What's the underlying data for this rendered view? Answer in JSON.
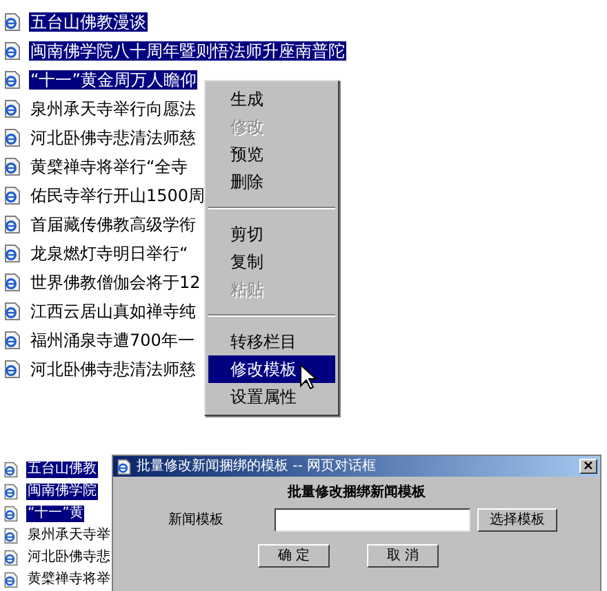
{
  "news_list": [
    {
      "title": "五台山佛教漫谈",
      "selected": true
    },
    {
      "title": "闽南佛学院八十周年暨则悟法师升座南普陀",
      "selected": true
    },
    {
      "title": "“十一”黄金周万人瞻仰",
      "selected": true
    },
    {
      "title": "泉州承天寺举行向愿法",
      "selected": false
    },
    {
      "title": "河北卧佛寺悲清法师慈",
      "selected": false
    },
    {
      "title": "黄檗禅寺将举行“全寺",
      "selected": false
    },
    {
      "title": "佑民寺举行开山1500周",
      "selected": false
    },
    {
      "title": "首届藏传佛教高级学衔",
      "selected": false
    },
    {
      "title": "龙泉燃灯寺明日举行“",
      "selected": false
    },
    {
      "title": "世界佛教僧伽会将于12",
      "selected": false
    },
    {
      "title": "江西云居山真如禅寺纯",
      "selected": false
    },
    {
      "title": "福州涌泉寺遭700年一",
      "selected": false
    },
    {
      "title": "河北卧佛寺悲清法师慈",
      "selected": false
    }
  ],
  "context_menu": [
    {
      "kind": "item",
      "label": "生成",
      "disabled": false,
      "selected": false
    },
    {
      "kind": "item",
      "label": "修改",
      "disabled": true,
      "selected": false
    },
    {
      "kind": "item",
      "label": "预览",
      "disabled": false,
      "selected": false
    },
    {
      "kind": "item",
      "label": "删除",
      "disabled": false,
      "selected": false
    },
    {
      "kind": "separator"
    },
    {
      "kind": "item",
      "label": "剪切",
      "disabled": false,
      "selected": false
    },
    {
      "kind": "item",
      "label": "复制",
      "disabled": false,
      "selected": false
    },
    {
      "kind": "item",
      "label": "粘贴",
      "disabled": true,
      "selected": false
    },
    {
      "kind": "separator"
    },
    {
      "kind": "item",
      "label": "转移栏目",
      "disabled": false,
      "selected": false
    },
    {
      "kind": "item",
      "label": "修改模板",
      "disabled": false,
      "selected": true
    },
    {
      "kind": "item",
      "label": "设置属性",
      "disabled": false,
      "selected": false
    }
  ],
  "background_list": [
    {
      "title": "五台山佛教",
      "selected": true
    },
    {
      "title": "闽南佛学院",
      "selected": true
    },
    {
      "title": "“十一”黄",
      "selected": true
    },
    {
      "title": "泉州承天寺举",
      "selected": false
    },
    {
      "title": "河北卧佛寺悲",
      "selected": false
    },
    {
      "title": "黄檗禅寺将举",
      "selected": false
    }
  ],
  "dialog": {
    "title": "批量修改新闻捆绑的模板 -- 网页对话框",
    "close": "×",
    "heading": "批量修改捆绑新闻模板",
    "field_label": "新闻模板",
    "choose_button": "选择模板",
    "ok_button": "确 定",
    "cancel_button": "取 消"
  }
}
